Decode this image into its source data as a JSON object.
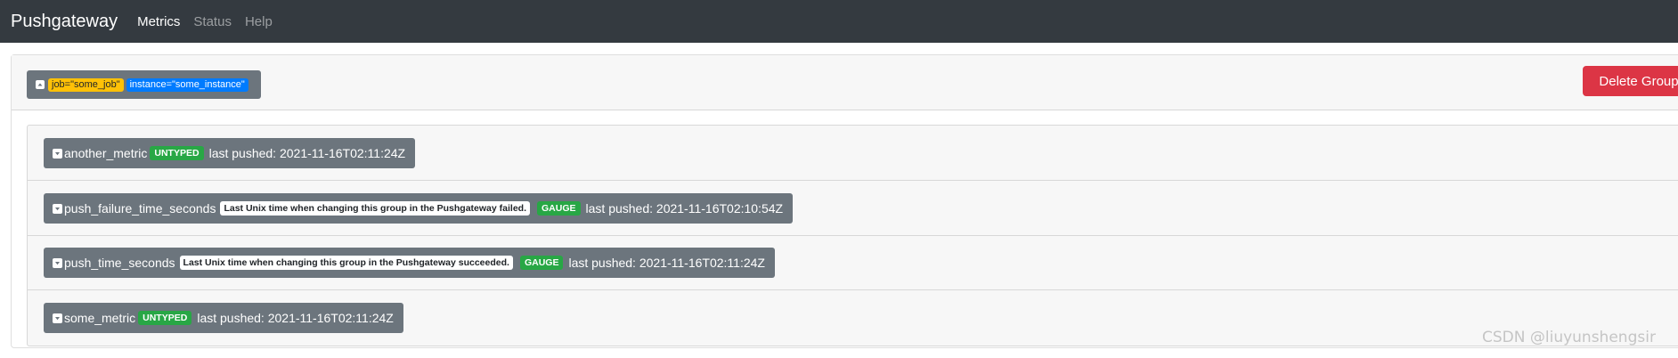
{
  "navbar": {
    "brand": "Pushgateway",
    "links": [
      {
        "label": "Metrics",
        "active": true
      },
      {
        "label": "Status",
        "active": false
      },
      {
        "label": "Help",
        "active": false
      }
    ],
    "background": "#343a40"
  },
  "group": {
    "labels": {
      "job": "job=\"some_job\"",
      "instance": "instance=\"some_instance\""
    },
    "delete_label": "Delete Group",
    "icon": "collapse-up-icon"
  },
  "metrics": [
    {
      "name": "another_metric",
      "help": "",
      "type": "UNTYPED",
      "last_pushed": "last pushed: 2021-11-16T02:11:24Z"
    },
    {
      "name": "push_failure_time_seconds",
      "help": "Last Unix time when changing this group in the Pushgateway failed.",
      "type": "GAUGE",
      "last_pushed": "last pushed: 2021-11-16T02:10:54Z"
    },
    {
      "name": "push_time_seconds",
      "help": "Last Unix time when changing this group in the Pushgateway succeeded.",
      "type": "GAUGE",
      "last_pushed": "last pushed: 2021-11-16T02:11:24Z"
    },
    {
      "name": "some_metric",
      "help": "",
      "type": "UNTYPED",
      "last_pushed": "last pushed: 2021-11-16T02:11:24Z"
    }
  ],
  "watermark": "CSDN @liuyunshengsir",
  "colors": {
    "secondary": "#6c757d",
    "danger": "#dc3545",
    "success": "#28a745",
    "warning": "#ffc107",
    "primary": "#007bff"
  }
}
